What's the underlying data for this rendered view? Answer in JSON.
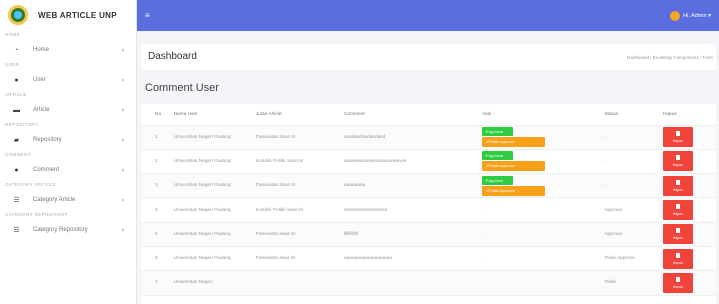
{
  "brand": {
    "name": "WEB ARTICLE UNP"
  },
  "sidebar": {
    "sections": [
      {
        "heading": "HOME",
        "item": {
          "label": "Home",
          "icon": "speedometer-icon"
        }
      },
      {
        "heading": "USER",
        "item": {
          "label": "User",
          "icon": "user-icon"
        }
      },
      {
        "heading": "ARTICLE",
        "item": {
          "label": "Article",
          "icon": "keyboard-icon"
        }
      },
      {
        "heading": "REPOSITORY",
        "item": {
          "label": "Repository",
          "icon": "folder-icon"
        }
      },
      {
        "heading": "COMMENT",
        "item": {
          "label": "Comment",
          "icon": "comment-icon"
        }
      },
      {
        "heading": "CATEGORY ARTICLE",
        "item": {
          "label": "Category Article",
          "icon": "list-icon"
        }
      },
      {
        "heading": "CATEGORY REPOSITORY",
        "item": {
          "label": "Category Repository",
          "icon": "list-icon"
        }
      }
    ]
  },
  "topbar": {
    "admin_label": "Hi, Admin ▾"
  },
  "header": {
    "title": "Dashboard",
    "breadcrumb": "Dashboard / Bootstrap Components / Form"
  },
  "section": {
    "title": "Comment User"
  },
  "table": {
    "headers": [
      "No",
      "Nama User",
      "Judul Article",
      "Comment",
      "Aksi",
      "Status",
      "Hapus"
    ],
    "approve_label": "✔Approve",
    "reject_label": "⊘Tidak Approve",
    "hapus_label": "Hapus",
    "rows": [
      {
        "no": "1",
        "user": "Universitas Negeri Padang",
        "judul": "Pariwisata Saat Ini",
        "comment": "asadasdasdasdasd",
        "aksi": "buttons",
        "status": "-"
      },
      {
        "no": "2",
        "user": "Universitas Negeri Padang",
        "judul": "Kondisi Politik Saat Ini",
        "comment": "wwwwwwwwwwwwwwwwww",
        "aksi": "buttons",
        "status": "-"
      },
      {
        "no": "3",
        "user": "Universitas Negeri Padang",
        "judul": "Pariwisata Saat Ini",
        "comment": "aaaaaaaa",
        "aksi": "buttons",
        "status": "-"
      },
      {
        "no": "4",
        "user": "Universitas Negeri Padang",
        "judul": "Kondisi Politik Saat Ini",
        "comment": "ssssssssssssssssss",
        "aksi": "-",
        "status": "Approve"
      },
      {
        "no": "5",
        "user": "Universitas Negeri Padang",
        "judul": "Pariwisata Saat Ini",
        "comment": "lllllllllllll",
        "aksi": "-",
        "status": "Approve"
      },
      {
        "no": "6",
        "user": "Universitas Negeri Padang",
        "judul": "Pariwisata Saat Ini",
        "comment": "aaaaaaaaaaaaaaaaaa",
        "aksi": "-",
        "status": "Tidak Approve"
      },
      {
        "no": "7",
        "user": "Universitas Negeri",
        "judul": "",
        "comment": "",
        "aksi": "",
        "status": "Tidak"
      }
    ]
  },
  "colors": {
    "topbar": "#5b6ee0",
    "approve": "#2ecc40",
    "reject": "#f9a01b",
    "hapus": "#f0433a"
  }
}
